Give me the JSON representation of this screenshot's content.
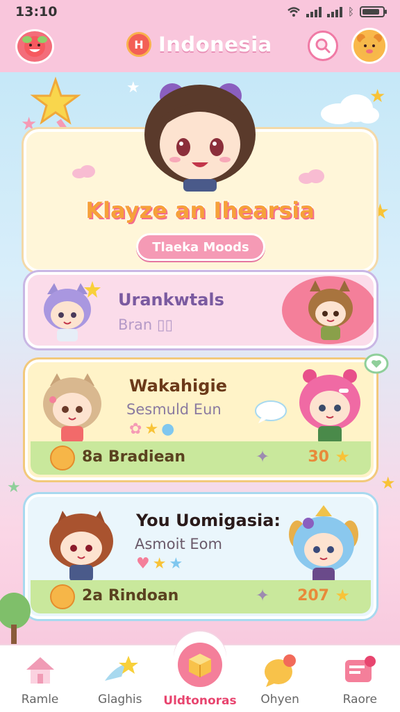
{
  "status": {
    "time": "13:10"
  },
  "header": {
    "title": "Indonesia",
    "flag_letter": "H"
  },
  "hero": {
    "title": "Klayze an Ihearsia",
    "button_label": "Tlaeka Moods"
  },
  "cards": [
    {
      "name": "Urankwtals",
      "subtitle": "Bran"
    },
    {
      "name": "Wakahigie",
      "subtitle": "Sesmuld Eun",
      "strip_label": "8a Bradiean",
      "strip_value": "30"
    },
    {
      "name": "You Uomigasia:",
      "subtitle": "Asmoit Eom",
      "strip_label": "2a Rindoan",
      "strip_value": "207"
    }
  ],
  "nav": [
    {
      "label": "Ramle",
      "icon": "house-icon"
    },
    {
      "label": "Glaghis",
      "icon": "shooting-star-icon"
    },
    {
      "label": "Uldtonoras",
      "icon": "cube-icon"
    },
    {
      "label": "Ohyen",
      "icon": "chat-bubble-icon"
    },
    {
      "label": "Raore",
      "icon": "message-icon"
    }
  ],
  "colors": {
    "accent": "#f59ab5",
    "active_nav": "#e8456f",
    "header_bg": "#f9c6dc"
  }
}
